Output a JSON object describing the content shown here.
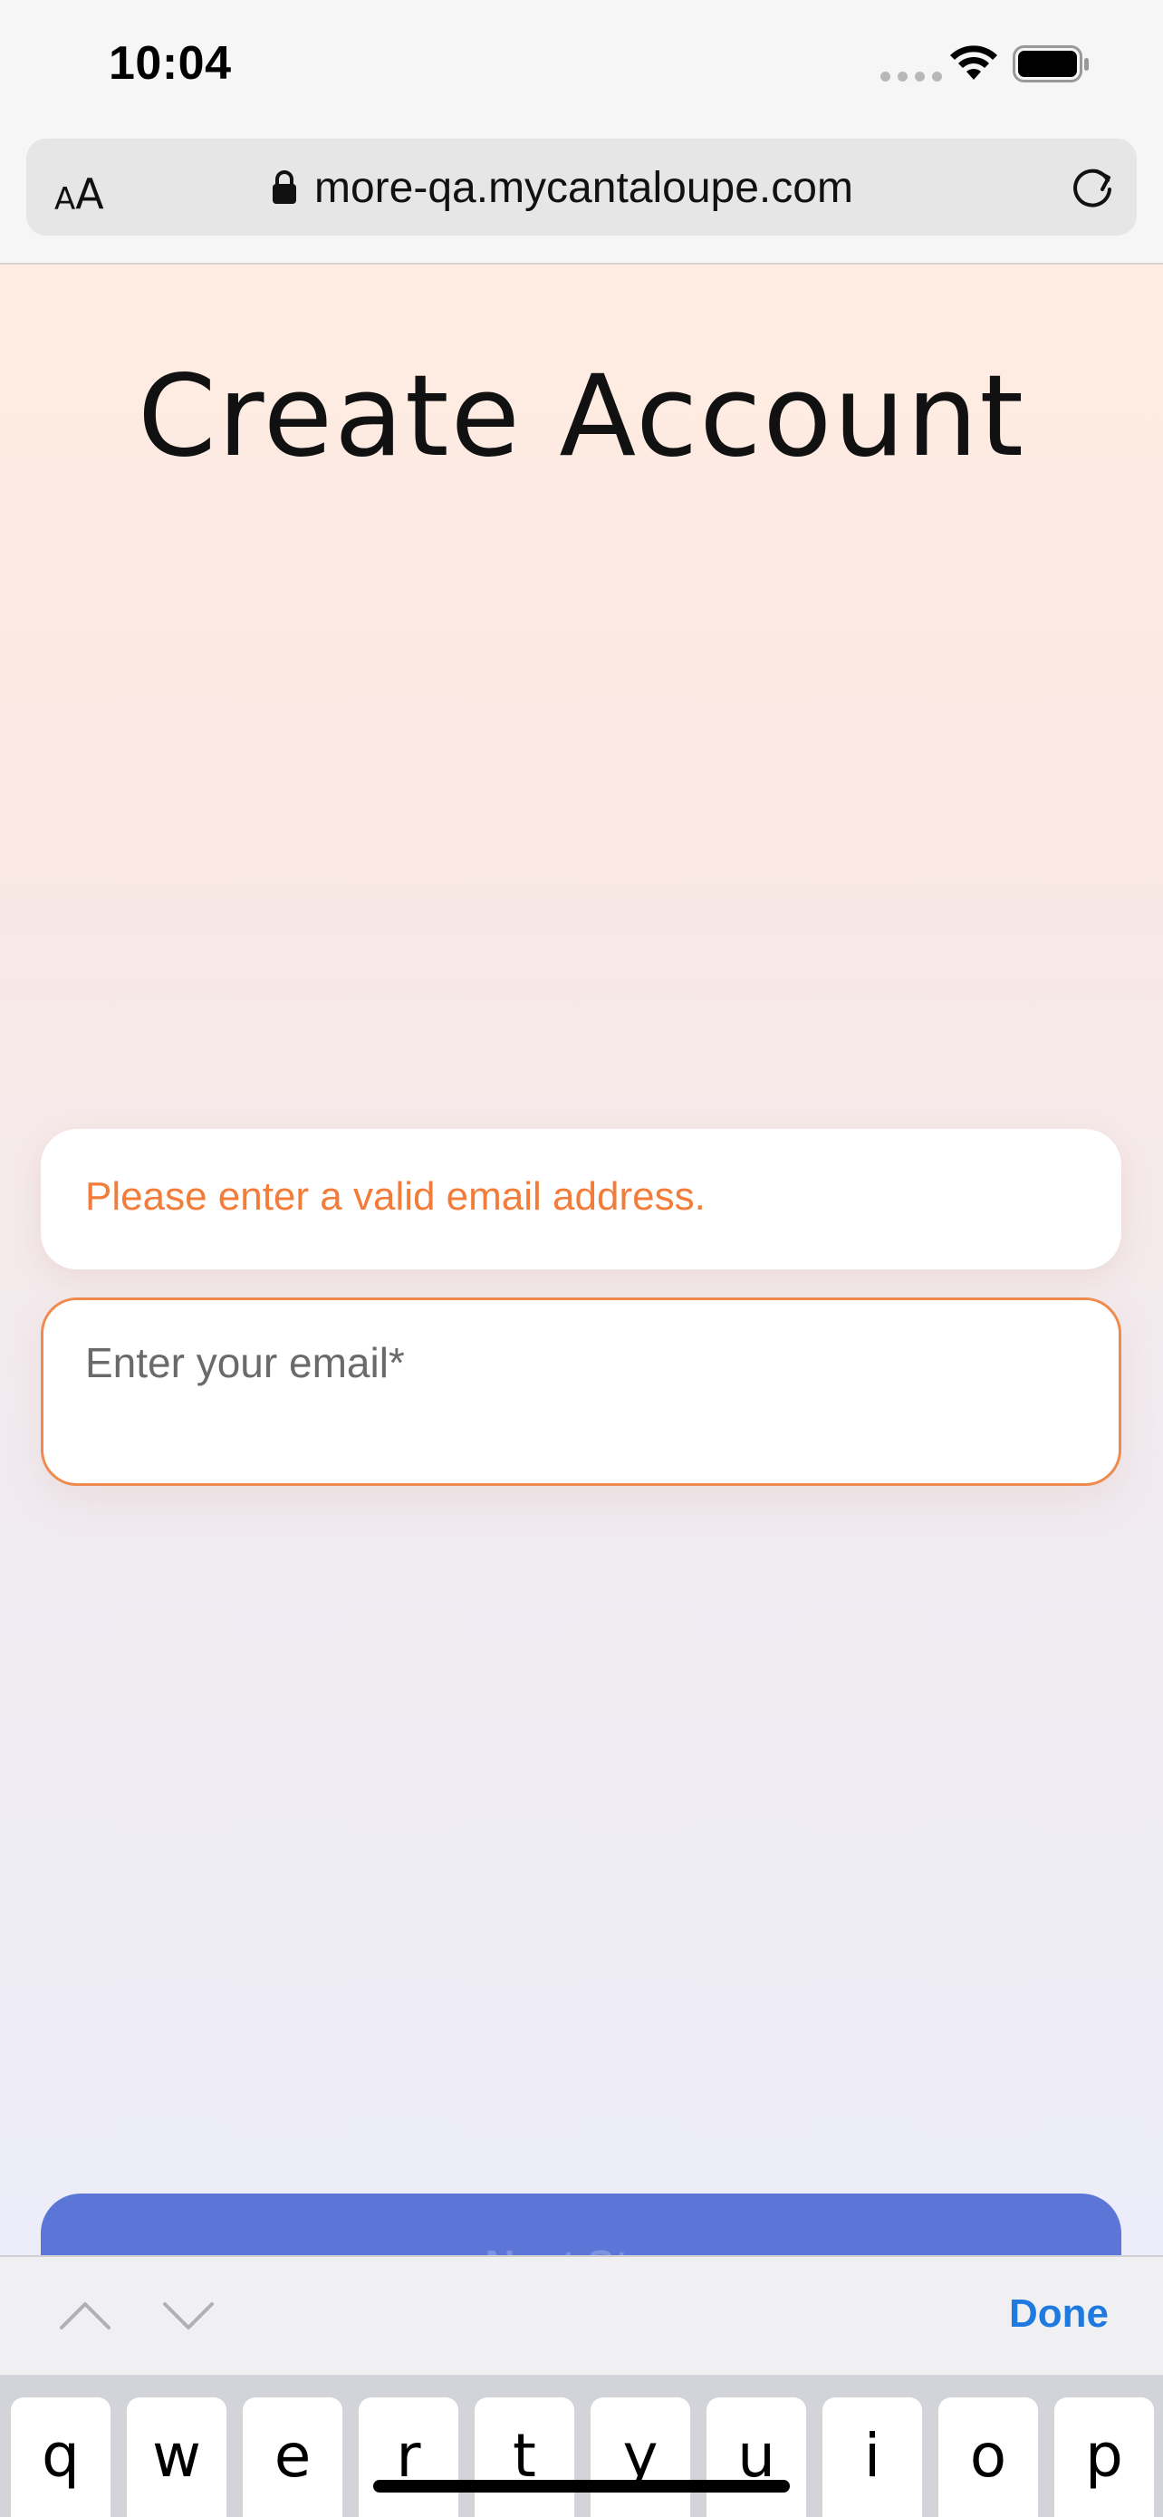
{
  "status_bar": {
    "time": "10:04",
    "signal_icon": "signal-dots-icon",
    "wifi_icon": "wifi-icon",
    "battery_icon": "battery-icon"
  },
  "browser": {
    "aa_label_small": "A",
    "aa_label_big": "A",
    "url": "more-qa.mycantaloupe.com",
    "lock_icon": "lock-icon",
    "reload_icon": "reload-icon"
  },
  "page": {
    "title": "Create Account",
    "error_message": "Please enter a valid email address.",
    "email_field": {
      "placeholder": "Enter your email*",
      "value": ""
    },
    "primary_button_label": "Next Step",
    "colors": {
      "error": "#f27d3a",
      "field_border": "#ef8a4e",
      "button": "#5b76d6"
    }
  },
  "accessory_bar": {
    "prev_icon": "chevron-up-icon",
    "next_icon": "chevron-down-icon",
    "done_label": "Done"
  },
  "keyboard": {
    "keys": [
      "q",
      "w",
      "e",
      "r",
      "t",
      "y",
      "u",
      "i",
      "o",
      "p"
    ]
  }
}
